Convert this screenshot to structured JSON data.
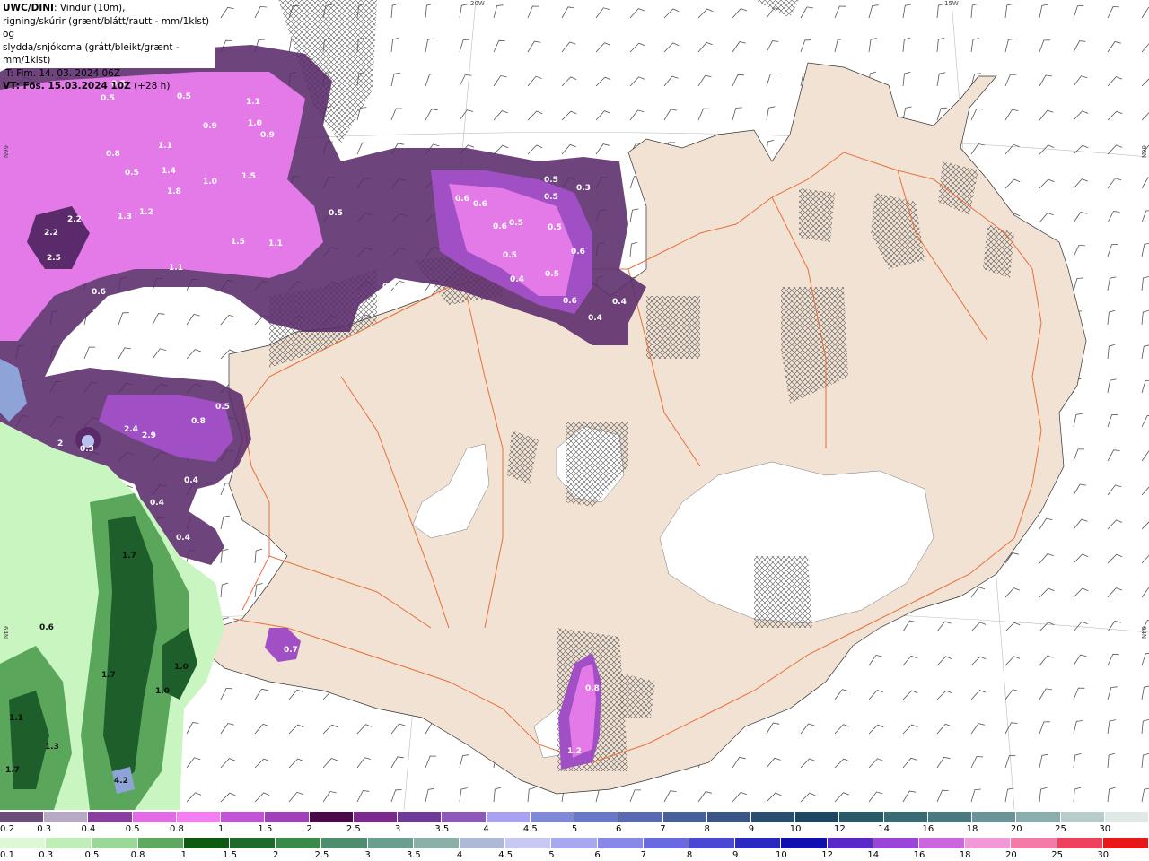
{
  "header": {
    "model": "UWC/DINI",
    "line1_rest": ": Vindur (10m),",
    "line2": "rigning/skúrir (grænt/blátt/rautt - mm/1klst) og",
    "line3": "slydda/snjókoma (grátt/bleikt/grænt - mm/1klst)",
    "issue_time": "IT: Fim. 14. 03. 2024 06Z",
    "valid_time": "VT: Fös. 15.03.2024 10Z",
    "lead": " (+28 h)"
  },
  "graticule": {
    "lon_20w": "20W",
    "lon_15w": "15W",
    "lat_66n_left": "66N",
    "lat_66n_right": "66N",
    "lat_64n_left": "64N",
    "lat_64n_right": "64N"
  },
  "colors": {
    "sea": "#ffffff",
    "land": "#f1e2d3",
    "glacier": "#ffffff",
    "roads": "#e8703a",
    "wind_barbs": "#555555",
    "snow_light": "#a04fc4",
    "snow_mid": "#e37ae8",
    "snow_dark": "#5a2a6a",
    "rain_light": "#c8f5c0",
    "rain_mid": "#5aa75c",
    "rain_dark": "#1e5e2a"
  },
  "precip_values": {
    "snow": [
      "0.5",
      "0.5",
      "0.5",
      "1.1",
      "1.0",
      "0.9",
      "0.9",
      "1.1",
      "0.8",
      "0.5",
      "1.4",
      "1.0",
      "1.5",
      "1.8",
      "1.2",
      "1.3",
      "2.2",
      "2.2",
      "2.5",
      "1.5",
      "1.1",
      "1.1",
      "0.6",
      "0.4",
      "0.5",
      "0.4",
      "0.3",
      "0.6",
      "0.6",
      "0.5",
      "0.5",
      "0.6",
      "0.5",
      "0.6",
      "0.5",
      "0.4",
      "0.6",
      "0.4",
      "0.4",
      "0.5",
      "0.5",
      "0.8",
      "2.4",
      "2.9",
      "0.3",
      "0.4",
      "0.4",
      "0.4",
      "0.5",
      "0.7",
      "0.8",
      "1.2",
      "2"
    ],
    "rain": [
      "1.7",
      "0.6",
      "1.0",
      "1.0",
      "1.7",
      "1.1",
      "1.3",
      "1.7",
      "4.2"
    ]
  },
  "legend": {
    "snow_scale": {
      "labels": [
        "0.2",
        "0.3",
        "0.4",
        "0.5",
        "0.8",
        "1",
        "1.5",
        "2",
        "2.5",
        "3",
        "3.5",
        "4",
        "4.5",
        "5",
        "6",
        "7",
        "8",
        "9",
        "10",
        "12",
        "14",
        "16",
        "18",
        "20",
        "25",
        "30"
      ],
      "colors": [
        "#6b4f7a",
        "#b8a9c4",
        "#8a3ea0",
        "#e26be6",
        "#f47ef2",
        "#c154d4",
        "#a040b8",
        "#4a0a4a",
        "#7a2a8a",
        "#6e3a98",
        "#8d58b8",
        "#a8a2f0",
        "#8088d8",
        "#6a78c8",
        "#5a6ab0",
        "#48609a",
        "#3a5684",
        "#2a4e6e",
        "#1e4660",
        "#2a5a6a",
        "#3a6a74",
        "#4a7a80",
        "#6a9498",
        "#8aaeae",
        "#b8cccc",
        "#e0e8e8"
      ]
    },
    "rain_scale": {
      "labels": [
        "0.1",
        "0.3",
        "0.5",
        "0.8",
        "1",
        "1.5",
        "2",
        "2.5",
        "3",
        "3.5",
        "4",
        "4.5",
        "5",
        "6",
        "7",
        "8",
        "9",
        "10",
        "12",
        "14",
        "16",
        "18",
        "20",
        "25",
        "30"
      ],
      "colors": [
        "#dcf8d4",
        "#bfeeb6",
        "#9ad897",
        "#5fa862",
        "#0e5a12",
        "#1e6a28",
        "#3a8a4a",
        "#4e8e6e",
        "#6a9e8e",
        "#8ab0a8",
        "#b0b8d8",
        "#c8c8f4",
        "#a8a8f0",
        "#8888e8",
        "#6a6ae0",
        "#4848d4",
        "#2a2ac0",
        "#1010b0",
        "#5a28c8",
        "#9a44d8",
        "#cc66e0",
        "#f098d8",
        "#f47aa8",
        "#f04060",
        "#e81818"
      ]
    }
  }
}
